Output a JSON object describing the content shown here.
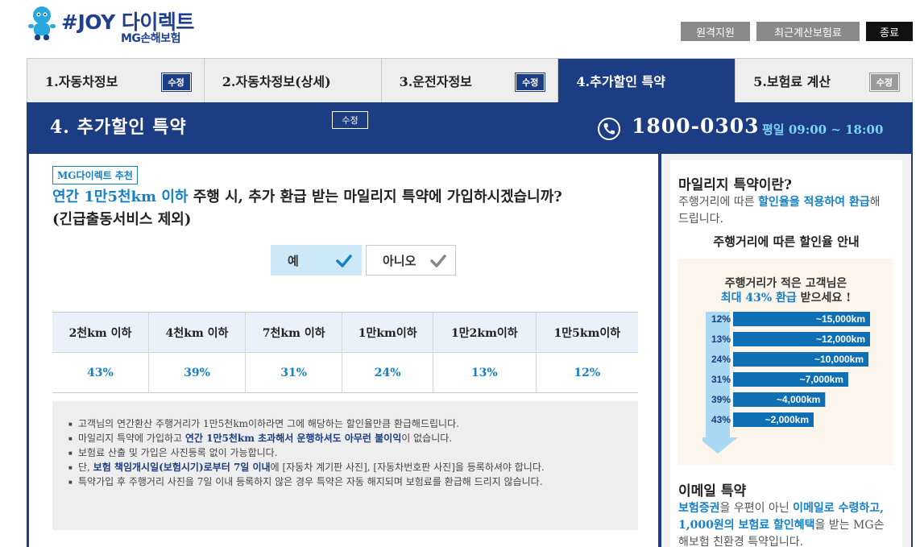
{
  "header": {
    "brand": "#JOY 다이렉트",
    "brand_sub": "MG손해보험",
    "buttons": {
      "remote": "원격지원",
      "recent": "최근계산보험료",
      "exit": "종료"
    }
  },
  "tabs": [
    {
      "label": "1.자동차정보",
      "badge": "수정"
    },
    {
      "label": "2.자동차정보(상세)",
      "badge": ""
    },
    {
      "label": "3.운전자정보",
      "badge": "수정"
    },
    {
      "label": "4.추가할인 특약",
      "badge": ""
    },
    {
      "label": "5.보험료 계산",
      "badge": "수정"
    }
  ],
  "section": {
    "title": "4. 추가할인 특약",
    "edit_label": "수정",
    "phone": "1800-0303",
    "hours": "평일 09:00 ~ 18:00"
  },
  "main": {
    "recommend": "MG다이렉트 추천",
    "question_highlight": "연간 1만5천km 이하",
    "question_rest": " 주행 시, 추가 환급 받는 마일리지 특약에 가입하시겠습니까?",
    "question_note": "(긴급출동서비스 제외)",
    "yes_label": "예",
    "no_label": "아니오",
    "rate_table": {
      "headers": [
        "2천km 이하",
        "4천km 이하",
        "7천km 이하",
        "1만km이하",
        "1만2km이하",
        "1만5km이하"
      ],
      "rates": [
        "43%",
        "39%",
        "31%",
        "24%",
        "13%",
        "12%"
      ]
    },
    "notes": {
      "n1": "고객님의 연간환산 주행거리가 1만5천km이하라면 그에 해당하는 할인율만큼 환급해드립니다.",
      "n2_a": "마일리지 특약에 가입하고 ",
      "n2_b": "연간 1만5천km 초과해서 운행하셔도 아무런 불이익",
      "n2_c": "이 없습니다.",
      "n3": "보험료 산출 및 가입은 사진등록 없이 가능합니다.",
      "n4_a": "단, ",
      "n4_b": "보험 책임개시일(보험시기)로부터 7일 이내",
      "n4_c": "에 [자동차 계기판 사진], [자동차번호판 사진]을 등록하셔야 합니다.",
      "n5": "특약가입 후 주행거리 사진을 7일 이내 등록하지 않은 경우 특약은 자동 해지되며 보험료를 환급해 드리지 않습니다."
    }
  },
  "side": {
    "mileage_title": "마일리지 특약이란?",
    "mileage_desc_a": "주행거리에 따른 ",
    "mileage_desc_b": "할인율을 적용하여 환급",
    "mileage_desc_c": "해드립니다.",
    "guide_title": "주행거리에 따른 할인율 안내",
    "info_line1": "주행거리가 적은 고객님은",
    "info_line2_b": "최대 43% 환급",
    "info_line2_c": " 받으세요 !",
    "email_title": "이메일 특약",
    "email_desc_a": "보험증권",
    "email_desc_b": "을 우편이 아닌 ",
    "email_desc_c": "이메일로 수령하고, 1,000원의 보험료 할인혜택",
    "email_desc_d": "을 받는 MG손해보험 친환경 특약입니다."
  },
  "chart_data": {
    "type": "bar",
    "categories": [
      "~15,000km",
      "~12,000km",
      "~10,000km",
      "~7,000km",
      "~4,000km",
      "~2,000km"
    ],
    "values": [
      12,
      13,
      24,
      31,
      39,
      43
    ],
    "value_labels": [
      "12%",
      "13%",
      "24%",
      "31%",
      "39%",
      "43%"
    ],
    "orientation": "horizontal",
    "colors": {
      "bar": "#0f6fb4",
      "arrow": "#a9d8f2"
    }
  },
  "colors": {
    "navy": "#1c3c83",
    "accent_blue": "#1680c6",
    "yes_bg": "#cde8f6"
  }
}
